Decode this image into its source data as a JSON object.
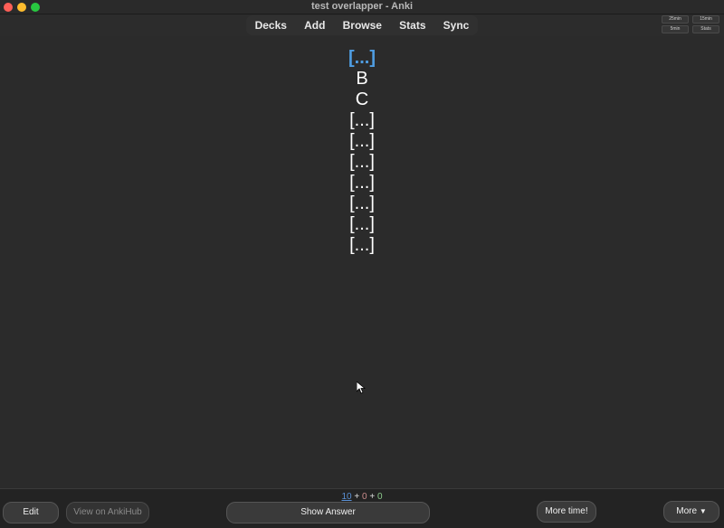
{
  "window": {
    "title": "test overlapper - Anki"
  },
  "toolbar": {
    "items": [
      "Decks",
      "Add",
      "Browse",
      "Stats",
      "Sync"
    ]
  },
  "mini_buttons": [
    "25min",
    "15min",
    "5min",
    "Stats"
  ],
  "card": {
    "lines": [
      {
        "text": "[...]",
        "active": true
      },
      {
        "text": "B",
        "active": false
      },
      {
        "text": "C",
        "active": false
      },
      {
        "text": "[...]",
        "active": false
      },
      {
        "text": "[...]",
        "active": false
      },
      {
        "text": "[...]",
        "active": false
      },
      {
        "text": "[...]",
        "active": false
      },
      {
        "text": "[...]",
        "active": false
      },
      {
        "text": "[...]",
        "active": false
      },
      {
        "text": "[...]",
        "active": false
      }
    ]
  },
  "bottom": {
    "counts": {
      "new": "10",
      "sep1": " + ",
      "learn": "0",
      "sep2": " + ",
      "review": "0"
    },
    "edit_label": "Edit",
    "ankihub_label": "View on AnkiHub",
    "show_answer_label": "Show Answer",
    "more_time_label": "More time!",
    "more_label": "More"
  },
  "colors": {
    "background": "#2c2c2c",
    "cloze_active": "#4f9de2",
    "new_count": "#5a91d6"
  }
}
